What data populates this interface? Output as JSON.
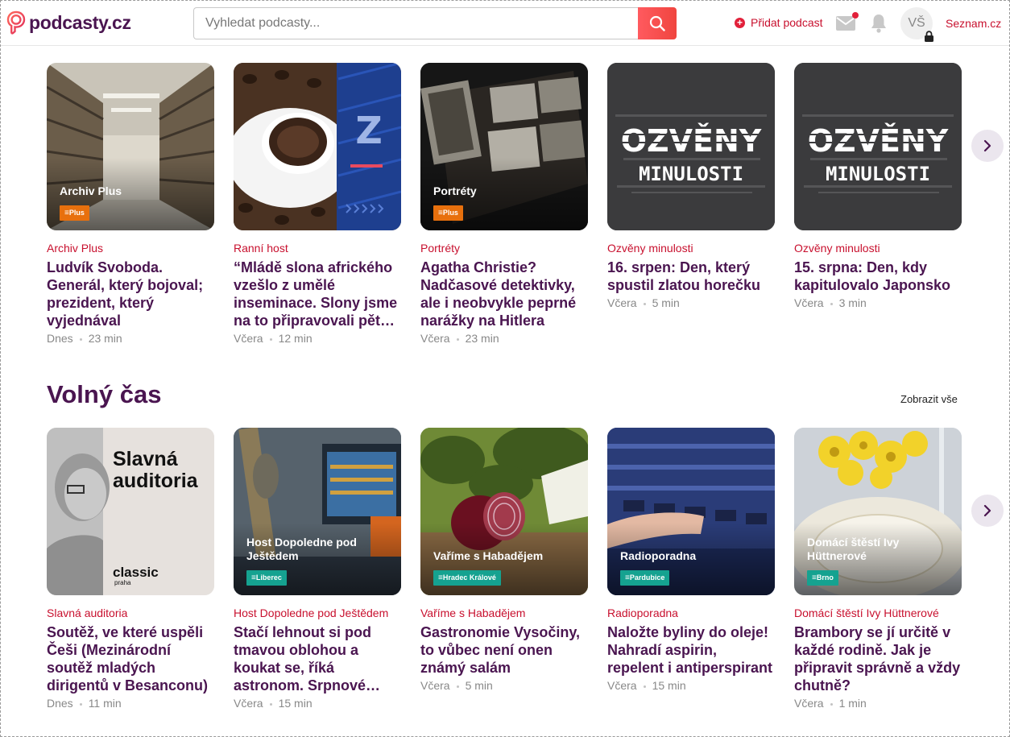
{
  "header": {
    "logo_text": "podcasty.cz",
    "search_placeholder": "Vyhledat podcasty...",
    "add_podcast": "Přidat podcast",
    "avatar_initials": "VŠ",
    "seznam_link": "Seznam.cz",
    "icons": [
      "search-icon",
      "mail-icon",
      "bell-icon",
      "lock-icon"
    ],
    "accent_color": "#c8102e",
    "brand_color": "#4a1550"
  },
  "row1": {
    "cards": [
      {
        "thumb_title": "Archiv Plus",
        "badge": "Plus",
        "show": "Archiv Plus",
        "title": "Ludvík Svoboda. Generál, který bojoval; prezident, který vyjednával",
        "date": "Dnes",
        "duration": "23 min"
      },
      {
        "thumb_title": "",
        "badge": "",
        "show": "Ranní host",
        "title": "“Mládě slona afrického vzešlo z umělé inseminace. Slony jsme na to připravovali pět…",
        "date": "Včera",
        "duration": "12 min"
      },
      {
        "thumb_title": "Portréty",
        "badge": "Plus",
        "show": "Portréty",
        "title": "Agatha Christie? Nadčasové detektivky, ale i neobvykle peprné narážky na Hitlera",
        "date": "Včera",
        "duration": "23 min"
      },
      {
        "thumb_title": "",
        "badge": "",
        "show": "Ozvěny minulosti",
        "title": "16. srpen: Den, který spustil zlatou horečku",
        "date": "Včera",
        "duration": "5 min",
        "art_text1": "OZVĚNY",
        "art_text2": "MINULOSTI"
      },
      {
        "thumb_title": "",
        "badge": "",
        "show": "Ozvěny minulosti",
        "title": "15. srpna: Den, kdy kapitulovalo Japonsko",
        "date": "Včera",
        "duration": "3 min",
        "art_text1": "OZVĚNY",
        "art_text2": "MINULOSTI"
      }
    ]
  },
  "section2": {
    "title": "Volný čas",
    "show_all": "Zobrazit vše",
    "cards": [
      {
        "thumb_title": "",
        "badge": "",
        "show": "Slavná auditoria",
        "title": "Soutěž, ve které uspěli Češi (Mezinárodní soutěž mladých dirigentů v Besanconu)",
        "date": "Dnes",
        "duration": "11 min",
        "art_text1": "Slavná auditoria",
        "art_logo": "classic",
        "art_logo_sub": "praha"
      },
      {
        "thumb_title": "Host Dopoledne pod Ještědem",
        "badge": "Liberec",
        "show": "Host Dopoledne pod Ještědem",
        "title": "Stačí lehnout si pod tmavou oblohou a koukat se, říká astronom. Srpnové…",
        "date": "Včera",
        "duration": "15 min"
      },
      {
        "thumb_title": "Vaříme s Habadějem",
        "badge": "Hradec Králové",
        "show": "Vaříme s Habadějem",
        "title": "Gastronomie Vysočiny, to vůbec není onen známý salám",
        "date": "Včera",
        "duration": "5 min"
      },
      {
        "thumb_title": "Radioporadna",
        "badge": "Pardubice",
        "show": "Radioporadna",
        "title": "Naložte byliny do oleje! Nahradí aspirin, repelent i antiperspirant",
        "date": "Včera",
        "duration": "15 min"
      },
      {
        "thumb_title": "Domácí štěstí Ivy Hüttnerové",
        "badge": "Brno",
        "show": "Domácí štěstí Ivy Hüttnerové",
        "title": "Brambory se jí určitě v každé rodině. Jak je připravit správně a vždy chutně?",
        "date": "Včera",
        "duration": "1 min"
      }
    ]
  }
}
